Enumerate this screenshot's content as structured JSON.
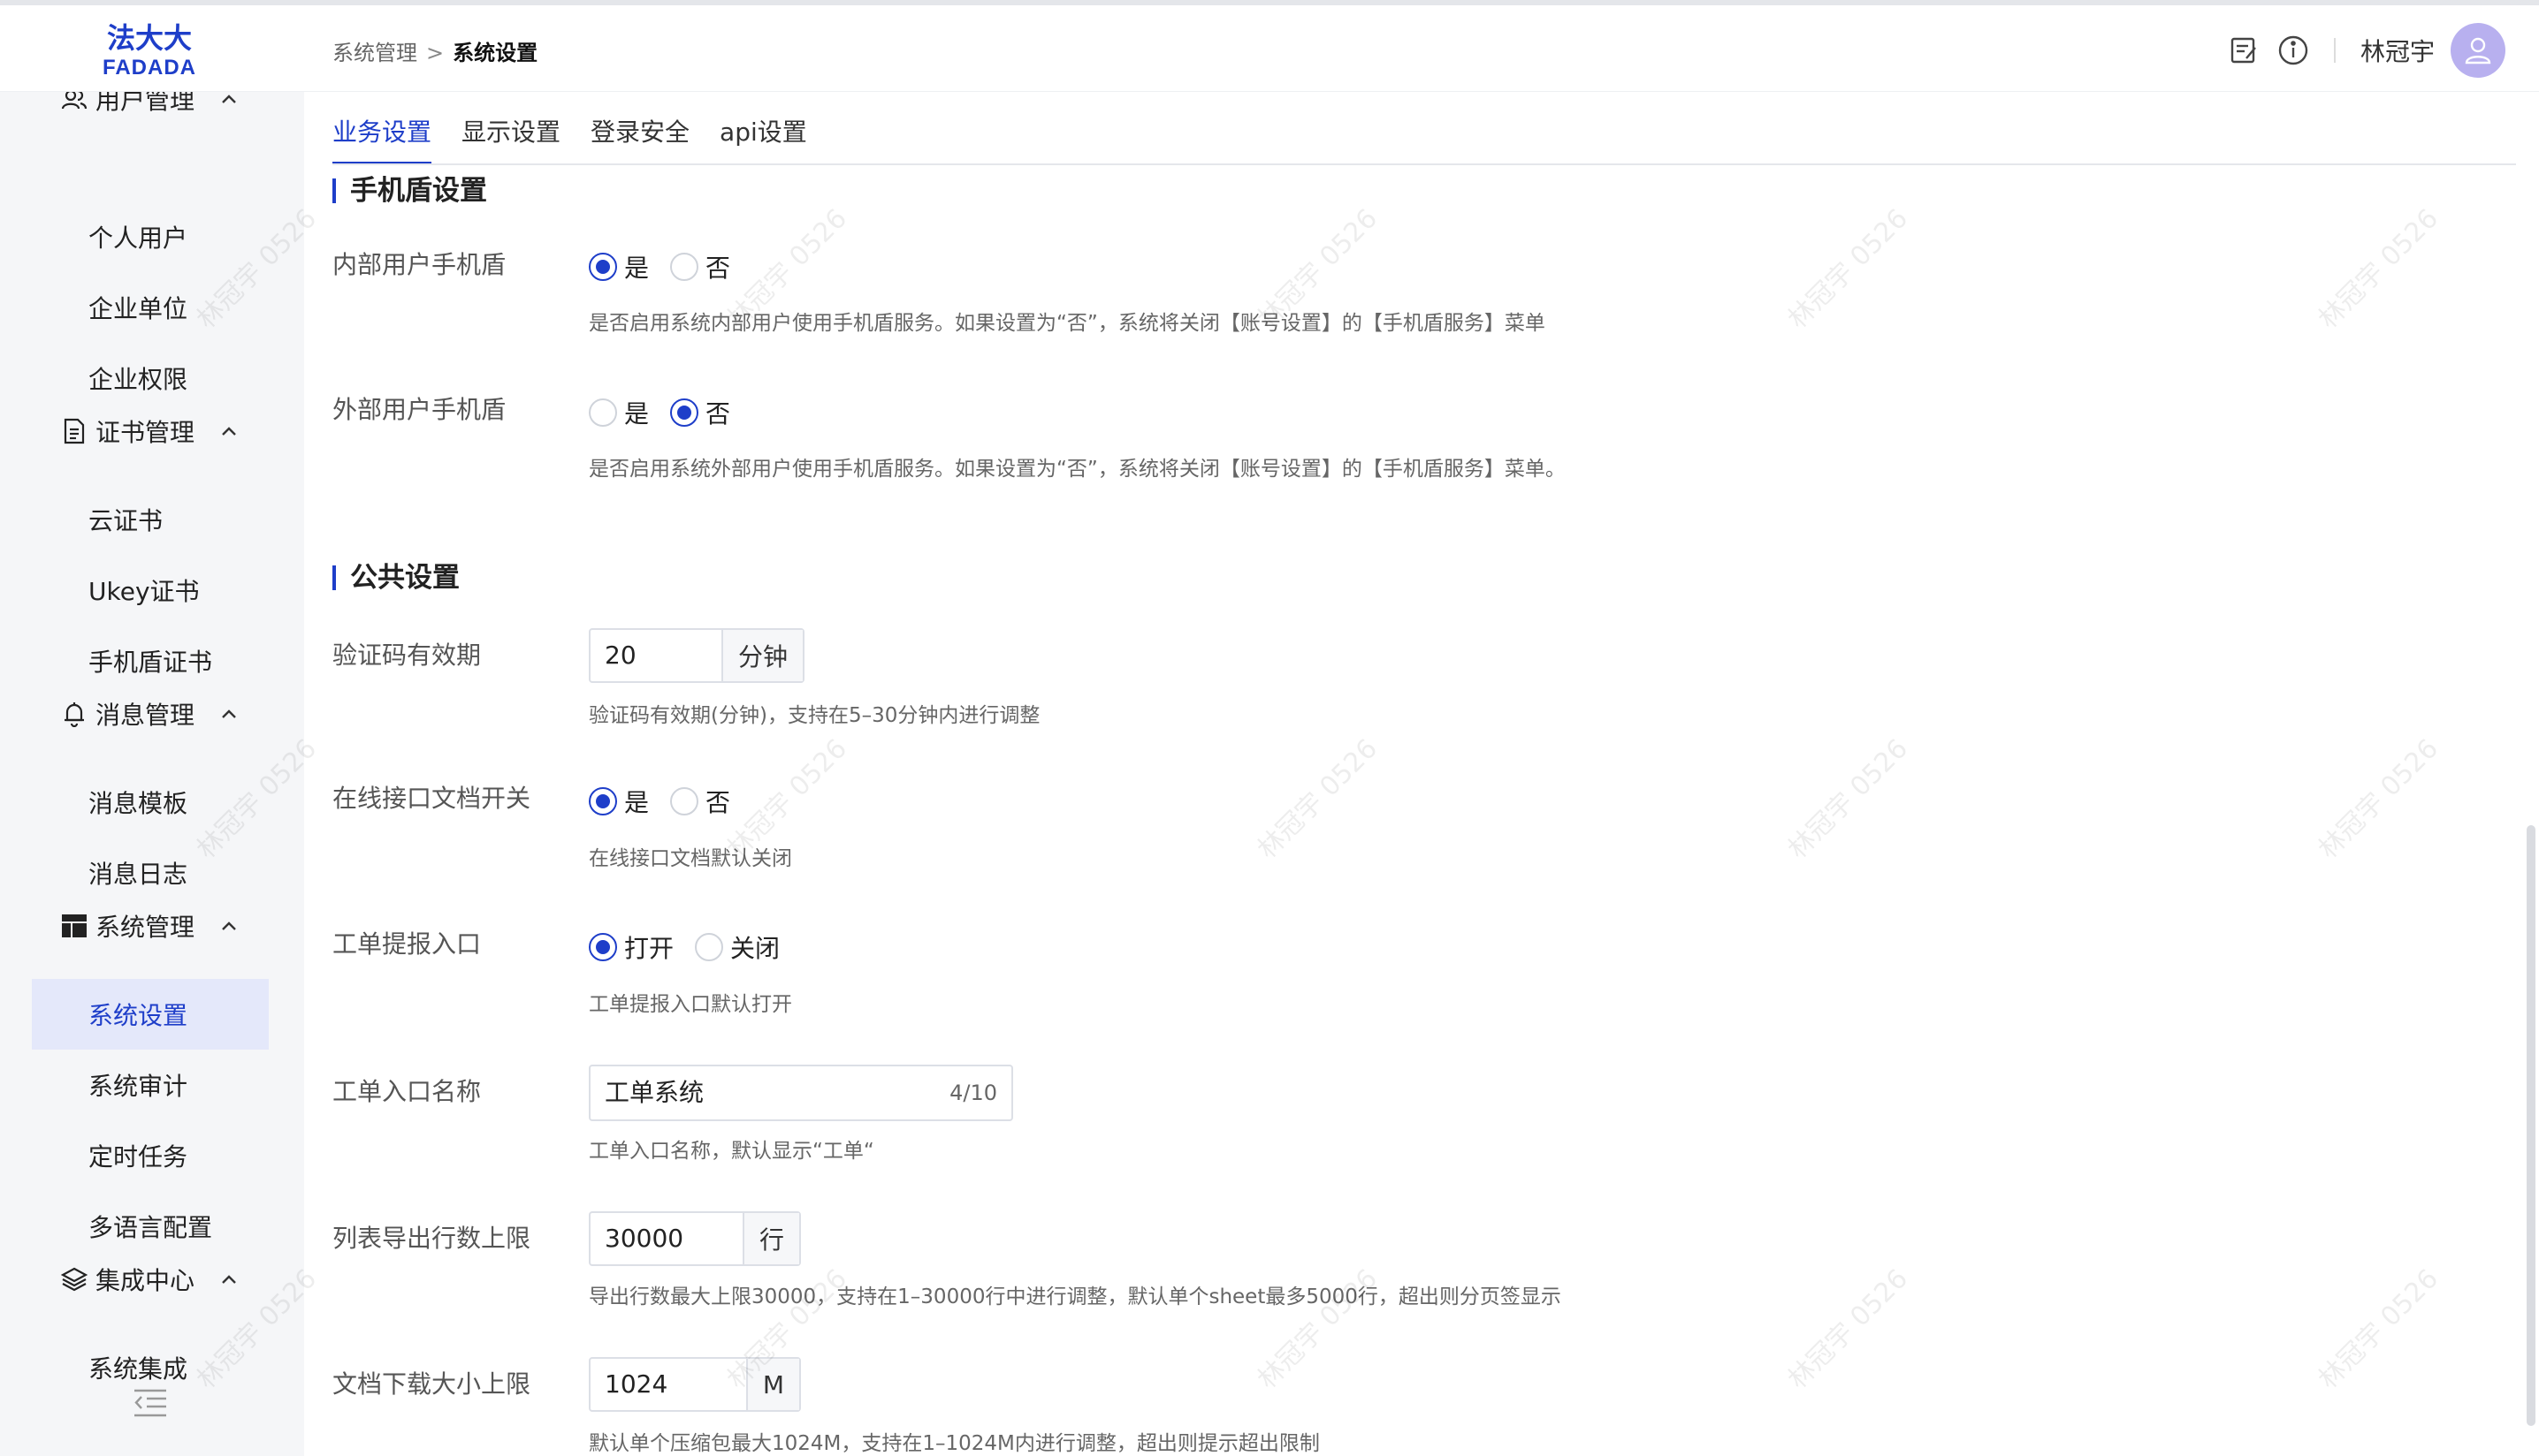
{
  "app": {
    "logo_text": "法大大 FADADA",
    "watermark": "林冠宇 0526"
  },
  "breadcrumb": {
    "parent": "系统管理",
    "separator": ">",
    "current": "系统设置"
  },
  "header": {
    "icons": [
      "notes-icon",
      "info-icon"
    ],
    "username": "林冠宇"
  },
  "sidebar": {
    "groups": [
      {
        "label": "用户管理",
        "icon": "users-icon",
        "items": [
          "个人用户",
          "企业单位",
          "企业权限"
        ]
      },
      {
        "label": "证书管理",
        "icon": "certificate-icon",
        "items": [
          "云证书",
          "Ukey证书",
          "手机盾证书"
        ]
      },
      {
        "label": "消息管理",
        "icon": "bell-icon",
        "items": [
          "消息模板",
          "消息日志"
        ]
      },
      {
        "label": "系统管理",
        "icon": "dashboard-icon",
        "items": [
          "系统设置",
          "系统审计",
          "定时任务",
          "多语言配置"
        ]
      },
      {
        "label": "集成中心",
        "icon": "layers-icon",
        "items": [
          "系统集成"
        ]
      }
    ],
    "active_item": "系统设置"
  },
  "tabs": [
    {
      "label": "业务设置",
      "active": true
    },
    {
      "label": "显示设置",
      "active": false
    },
    {
      "label": "登录安全",
      "active": false
    },
    {
      "label": "api设置",
      "active": false
    }
  ],
  "sections": {
    "mobile_shield": {
      "title": "手机盾设置",
      "internal": {
        "label": "内部用户手机盾",
        "options": [
          "是",
          "否"
        ],
        "selected": "是",
        "help": "是否启用系统内部用户使用手机盾服务。如果设置为“否”，系统将关闭【账号设置】的【手机盾服务】菜单"
      },
      "external": {
        "label": "外部用户手机盾",
        "options": [
          "是",
          "否"
        ],
        "selected": "否",
        "help": "是否启用系统外部用户使用手机盾服务。如果设置为“否”，系统将关闭【账号设置】的【手机盾服务】菜单。"
      }
    },
    "public": {
      "title": "公共设置",
      "code_validity": {
        "label": "验证码有效期",
        "value": "20",
        "unit": "分钟",
        "help": "验证码有效期(分钟)，支持在5–30分钟内进行调整"
      },
      "online_doc": {
        "label": "在线接口文档开关",
        "options": [
          "是",
          "否"
        ],
        "selected": "是",
        "help": "在线接口文档默认关闭"
      },
      "ticket_entry": {
        "label": "工单提报入口",
        "options": [
          "打开",
          "关闭"
        ],
        "selected": "打开",
        "help": "工单提报入口默认打开"
      },
      "ticket_name": {
        "label": "工单入口名称",
        "value": "工单系统",
        "counter": "4/10",
        "help": "工单入口名称，默认显示“工单“"
      },
      "export_limit": {
        "label": "列表导出行数上限",
        "value": "30000",
        "unit": "行",
        "help": "导出行数最大上限30000，支持在1–30000行中进行调整，默认单个sheet最多5000行，超出则分页签显示"
      },
      "download_limit": {
        "label": "文档下载大小上限",
        "value": "1024",
        "unit": "M",
        "help": "默认单个压缩包最大1024M，支持在1–1024M内进行调整，超出则提示超出限制"
      }
    }
  },
  "colors": {
    "primary": "#1e3ec9",
    "active_bg": "#e4e8fa",
    "avatar": "#b8b0ef"
  }
}
